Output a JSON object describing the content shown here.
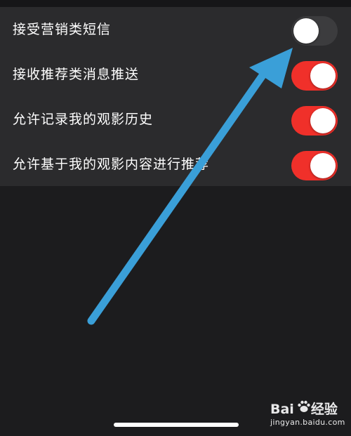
{
  "settings": [
    {
      "label": "接受营销类短信",
      "enabled": false
    },
    {
      "label": "接收推荐类消息推送",
      "enabled": true
    },
    {
      "label": "允许记录我的观影历史",
      "enabled": true
    },
    {
      "label": "允许基于我的观影内容进行推荐",
      "enabled": true
    }
  ],
  "colors": {
    "toggle_on": "#f0302a",
    "toggle_off": "#3c3c3e",
    "arrow": "#3a9fd8",
    "list_background": "#2b2b2d",
    "page_background": "#1c1c1e"
  },
  "watermark": {
    "brand_left": "Bai",
    "brand_right": "经验",
    "url": "jingyan.baidu.com"
  }
}
